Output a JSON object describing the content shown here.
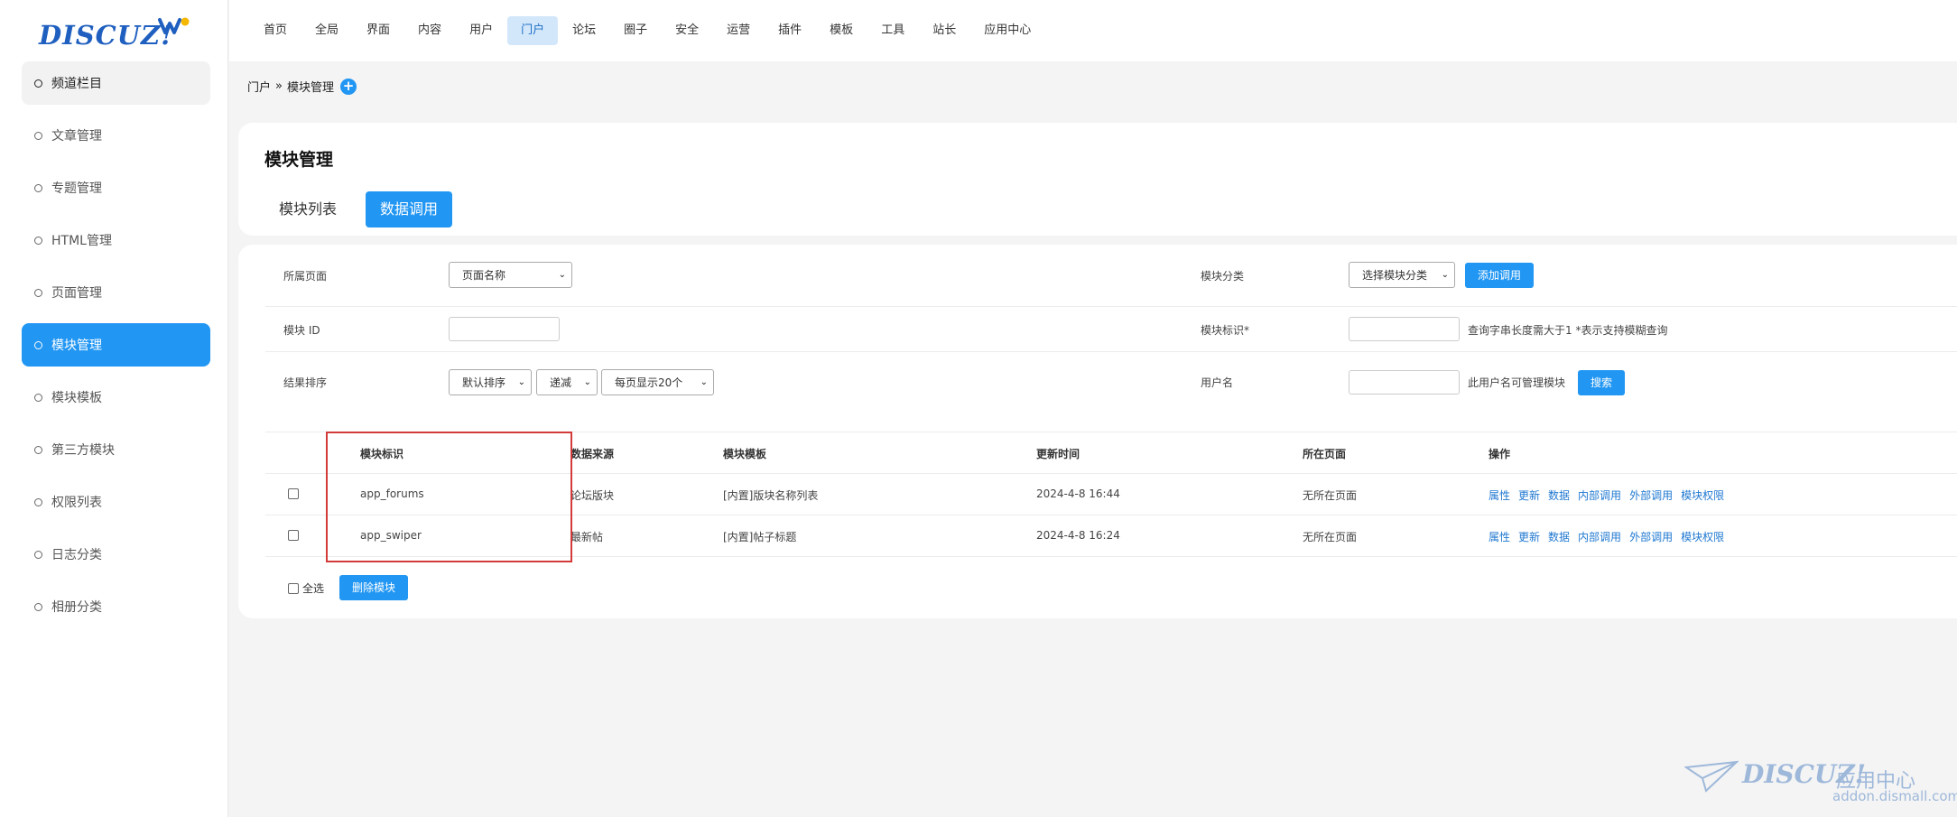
{
  "logo": {
    "text": "DISCUZ!"
  },
  "sidebar": {
    "items": [
      {
        "label": "频道栏目"
      },
      {
        "label": "文章管理"
      },
      {
        "label": "专题管理"
      },
      {
        "label": "HTML管理"
      },
      {
        "label": "页面管理"
      },
      {
        "label": "模块管理"
      },
      {
        "label": "模块模板"
      },
      {
        "label": "第三方模块"
      },
      {
        "label": "权限列表"
      },
      {
        "label": "日志分类"
      },
      {
        "label": "相册分类"
      }
    ],
    "active_index": 5
  },
  "topnav": {
    "items": [
      {
        "label": "首页"
      },
      {
        "label": "全局"
      },
      {
        "label": "界面"
      },
      {
        "label": "内容"
      },
      {
        "label": "用户"
      },
      {
        "label": "门户"
      },
      {
        "label": "论坛"
      },
      {
        "label": "圈子"
      },
      {
        "label": "安全"
      },
      {
        "label": "运营"
      },
      {
        "label": "插件"
      },
      {
        "label": "模板"
      },
      {
        "label": "工具"
      },
      {
        "label": "站长"
      },
      {
        "label": "应用中心"
      }
    ],
    "active_index": 5
  },
  "breadcrumb": {
    "root": "门户",
    "sep": "»",
    "current": "模块管理",
    "plus": "+"
  },
  "header": {
    "title": "模块管理",
    "tabs": [
      {
        "label": "模块列表"
      },
      {
        "label": "数据调用"
      }
    ]
  },
  "filters": {
    "page_label": "所属页面",
    "page_select": "页面名称",
    "category_label": "模块分类",
    "category_select": "选择模块分类",
    "add_button": "添加调用",
    "id_label": "模块 ID",
    "mark_label": "模块标识*",
    "mark_hint": "查询字串长度需大于1 *表示支持模糊查询",
    "sort_label": "结果排序",
    "sort_select": "默认排序",
    "order_select": "递减",
    "perpage_select": "每页显示20个",
    "user_label": "用户名",
    "user_hint": "此用户名可管理模块",
    "search_button": "搜索"
  },
  "table": {
    "headers": [
      "模块标识",
      "数据来源",
      "模块模板",
      "更新时间",
      "所在页面",
      "操作"
    ],
    "rows": [
      {
        "mark": "app_forums",
        "source": "论坛版块",
        "template": "[内置]版块名称列表",
        "updated": "2024-4-8 16:44",
        "page": "无所在页面"
      },
      {
        "mark": "app_swiper",
        "source": "最新帖",
        "template": "[内置]帖子标题",
        "updated": "2024-4-8 16:24",
        "page": "无所在页面"
      }
    ],
    "ops": [
      "属性",
      "更新",
      "数据",
      "内部调用",
      "外部调用",
      "模块权限"
    ],
    "select_all": "全选",
    "delete_button": "删除模块"
  },
  "watermark": {
    "brand": "DISCUZ!",
    "sub": "应用中心",
    "url": "addon.dismall.com"
  },
  "colors": {
    "accent": "#2196f3",
    "highlight_box": "#d33a3a",
    "link": "#1f78d1"
  }
}
